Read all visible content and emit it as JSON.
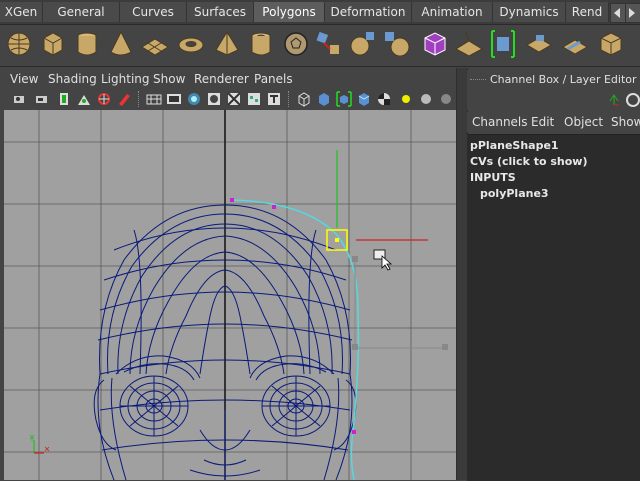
{
  "shelf_tabs": [
    "XGen",
    "General",
    "Curves",
    "Surfaces",
    "Polygons",
    "Deformation",
    "Animation",
    "Dynamics",
    "Rend"
  ],
  "active_tab": "Polygons",
  "shelf_icons": [
    "sphere-icon",
    "cube-icon",
    "cylinder-icon",
    "cone-icon",
    "plane-icon",
    "torus-icon",
    "pyramid-icon",
    "pipe-icon",
    "soccer-ball-icon",
    "combine-icon",
    "separate-icon",
    "smooth-icon",
    "mirror-icon",
    "soft-select-icon",
    "extrude-icon",
    "bridge-icon",
    "append-icon",
    "bevel-icon",
    "merge-icon",
    "split-icon",
    "poke-icon"
  ],
  "panel_menu": [
    "View",
    "Shading",
    "Lighting",
    "Show",
    "Renderer",
    "Panels"
  ],
  "panel_toolbar_icons": [
    "camera-icon",
    "camera-attr-icon",
    "bookmark-icon",
    "image-plane-icon",
    "2d-pan-icon",
    "grease-pencil-icon",
    "grid-icon",
    "film-gate-icon",
    "resolution-gate-icon",
    "gate-mask-icon",
    "field-chart-icon",
    "safe-action-icon",
    "safe-title-icon",
    "wireframe-icon",
    "smooth-shade-icon",
    "wireframe-on-shaded-icon",
    "textured-icon",
    "use-lights-icon",
    "shadows-icon",
    "ambient-occlusion-icon"
  ],
  "channel_box": {
    "title": "Channel Box / Layer Editor",
    "menu": [
      "Channels",
      "Edit",
      "Object",
      "Show"
    ],
    "shape_name": "pPlaneShape1",
    "cvs_label": "CVs (click to show)",
    "inputs_label": "INPUTS",
    "input_node": "polyPlane3"
  },
  "colors": {
    "viewport_bg": "#a0a0a0",
    "grid_line": "#5a5a5a",
    "wireframe": "#0a1a7a",
    "curve": "#55d8e0",
    "selection": "#ffff00",
    "x_axis": "#d02020",
    "y_axis": "#20c020",
    "active_tab": "#5d5d5d"
  }
}
